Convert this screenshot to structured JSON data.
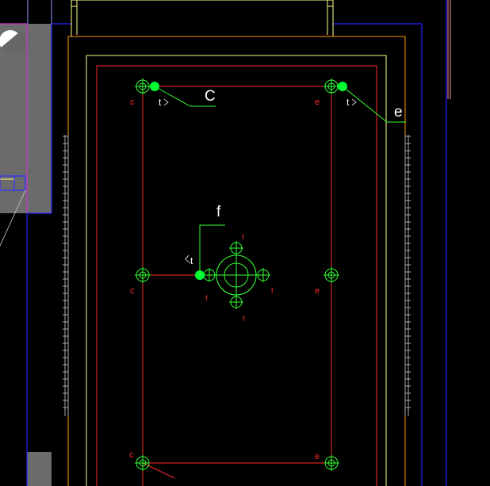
{
  "colors": {
    "background": "#000000",
    "red_line": "#ff2a2a",
    "green_line": "#33ff33",
    "green_node": "#00ff33",
    "yellow_line": "#ffff88",
    "orange_line": "#ff9900",
    "blue_line": "#2222ff",
    "magenta_line": "#cc33cc",
    "gray_wall": "#6b6b6b"
  },
  "callouts": {
    "top_left_tag": "C",
    "top_right_tag": "e",
    "center_tag": "f"
  },
  "node_labels": {
    "top_left_row": "c",
    "top_left_t": "t",
    "top_right_row": "e",
    "top_right_t": "t",
    "mid_left": "c",
    "mid_right": "e",
    "center_t": "t",
    "center_f_left": "f",
    "center_f_top": "f",
    "center_f_right": "f",
    "center_f_bottom": "f",
    "bottom_left": "c",
    "bottom_right": "e"
  },
  "icons": {
    "drawing_canvas": "cad-drawing",
    "wall_symbol": "circle-hatch-icon"
  }
}
